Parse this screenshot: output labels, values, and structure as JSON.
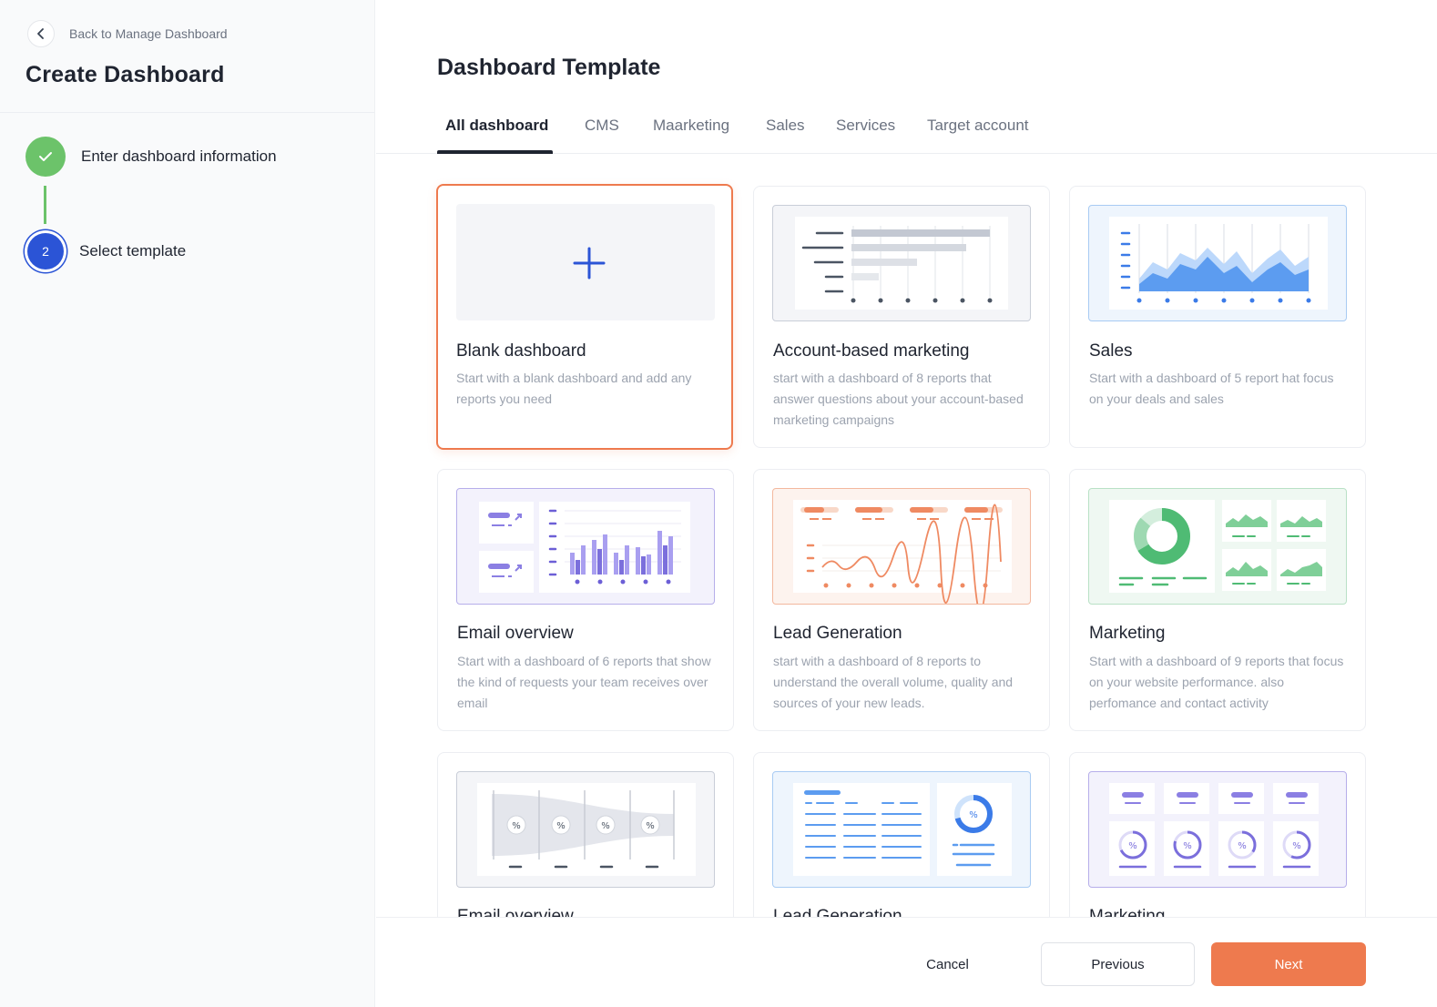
{
  "sidebar": {
    "back_label": "Back to Manage Dashboard",
    "title": "Create Dashboard",
    "steps": [
      {
        "label": "Enter dashboard information",
        "status": "completed"
      },
      {
        "label": "Select template",
        "number": "2",
        "status": "active"
      }
    ]
  },
  "main": {
    "title": "Dashboard Template",
    "tabs": [
      {
        "label": "All dashboard",
        "active": true
      },
      {
        "label": "CMS"
      },
      {
        "label": "Maarketing"
      },
      {
        "label": "Sales"
      },
      {
        "label": "Services"
      },
      {
        "label": "Target account"
      }
    ],
    "cards": [
      {
        "title": "Blank dashboard",
        "description": "Start with a blank dashboard and add any reports you need",
        "selected": true,
        "thumb": "plus-icon"
      },
      {
        "title": "Account-based marketing",
        "description": "start with a dashboard of 8 reports that answer questions about your account-based marketing campaigns",
        "thumb": "horizontal-bar-chart"
      },
      {
        "title": "Sales",
        "description": "Start with a dashboard of 5 report hat focus on your deals and sales",
        "thumb": "area-chart"
      },
      {
        "title": "Email overview",
        "description": "Start with a dashboard of 6 reports that show the kind of requests your team receives over email",
        "thumb": "bar-chart"
      },
      {
        "title": "Lead Generation",
        "description": "start with a dashboard of 8 reports to understand the overall volume, quality and sources of your new leads.",
        "thumb": "line-chart"
      },
      {
        "title": "Marketing",
        "description": "Start with a dashboard of 9 reports that focus on your website performance. also perfomance and contact activity",
        "thumb": "donut-chart"
      },
      {
        "title": "Email overview",
        "description": "",
        "thumb": "funnel-chart"
      },
      {
        "title": "Lead Generation",
        "description": "",
        "thumb": "list-gauge"
      },
      {
        "title": "Marketing",
        "description": "",
        "thumb": "percent-gauges"
      }
    ]
  },
  "footer": {
    "cancel_label": "Cancel",
    "previous_label": "Previous",
    "next_label": "Next"
  },
  "colors": {
    "accent": "#ee7a4e",
    "step_done": "#6cc36a",
    "step_active": "#2b54d6",
    "text_dark": "#1f2430",
    "text_muted": "#9ca3af"
  }
}
